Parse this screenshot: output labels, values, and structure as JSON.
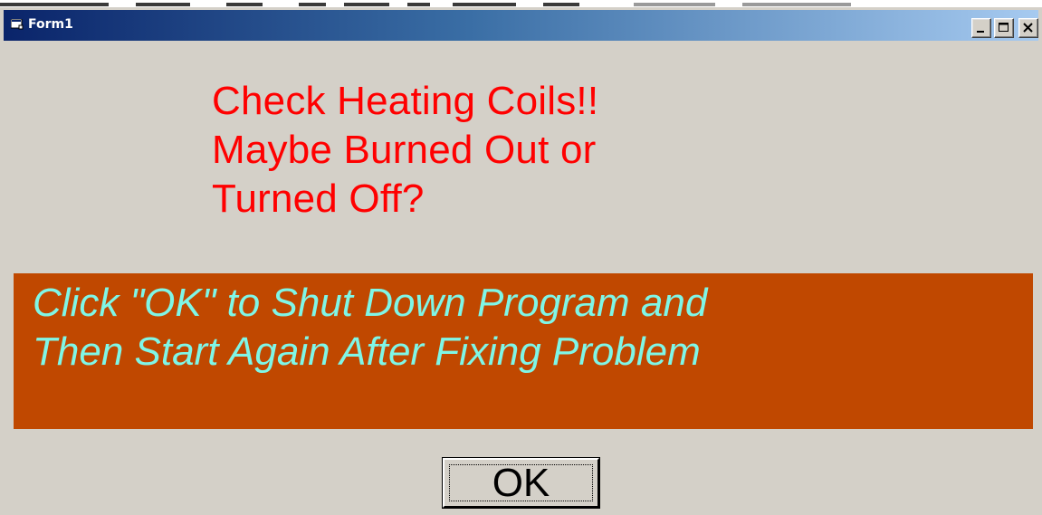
{
  "window": {
    "title": "Form1",
    "titlebar_gradient": [
      "#0a246a",
      "#a6caf0"
    ],
    "controls": {
      "minimize": "minimize-icon",
      "maximize": "maximize-icon",
      "close": "close-icon"
    }
  },
  "warning": {
    "lines": [
      "Check Heating Coils!!",
      "Maybe Burned Out or",
      "Turned Off?"
    ],
    "color": "#ff0000"
  },
  "instructions": {
    "lines": [
      "Click \"OK\" to Shut Down Program and",
      "Then Start Again After Fixing Problem"
    ],
    "text_color": "#7ff6e6",
    "background": "#c04800"
  },
  "ok_button": {
    "label": "OK"
  },
  "colors": {
    "form_background": "#d4d0c8"
  }
}
